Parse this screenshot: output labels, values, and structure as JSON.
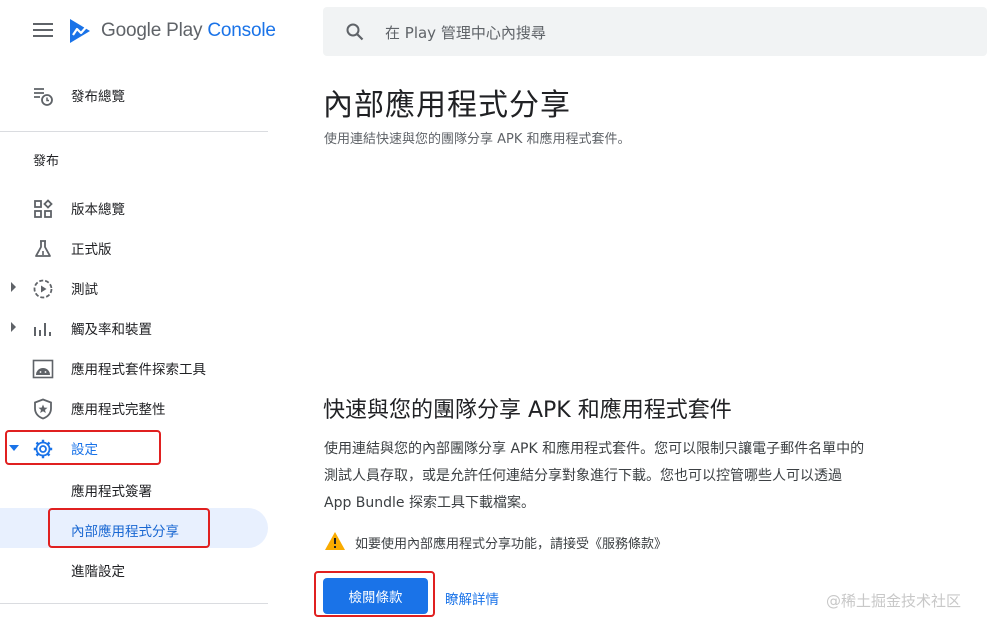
{
  "header": {
    "logo_word_google_play": "Google Play",
    "logo_word_console": "Console",
    "search_placeholder": "在 Play 管理中心內搜尋"
  },
  "sidebar": {
    "overview_label": "發布總覽",
    "section_title": "發布",
    "items": [
      {
        "label": "版本總覽",
        "icon": "dashboard-icon"
      },
      {
        "label": "正式版",
        "icon": "flask-icon"
      },
      {
        "label": "測試",
        "icon": "play-circle-icon"
      },
      {
        "label": "觸及率和裝置",
        "icon": "bar-chart-icon"
      },
      {
        "label": "應用程式套件探索工具",
        "icon": "android-icon"
      },
      {
        "label": "應用程式完整性",
        "icon": "shield-star-icon"
      },
      {
        "label": "設定",
        "icon": "gear-icon"
      }
    ],
    "sub_items": [
      {
        "label": "應用程式簽署"
      },
      {
        "label": "內部應用程式分享"
      },
      {
        "label": "進階設定"
      }
    ]
  },
  "main": {
    "title": "內部應用程式分享",
    "subtitle": "使用連結快速與您的團隊分享 APK 和應用程式套件。",
    "section_title": "快速與您的團隊分享 APK 和應用程式套件",
    "body_lines": [
      "使用連結與您的內部團隊分享 APK 和應用程式套件。您可以限制只讓電子郵件名單中的",
      "測試人員存取，或是允許任何連結分享對象進行下載。您也可以控管哪些人可以透過",
      "App Bundle 探索工具下載檔案。"
    ],
    "warning_text": "如要使用內部應用程式分享功能，請接受《服務條款》",
    "review_button": "檢閱條款",
    "learn_more_link": "瞭解詳情"
  },
  "watermark": "@稀土掘金技术社区",
  "colors": {
    "accent": "#1a73e8",
    "active_bg": "#e8f0fe",
    "highlight_box": "#e02020",
    "warning": "#f9ab00"
  }
}
